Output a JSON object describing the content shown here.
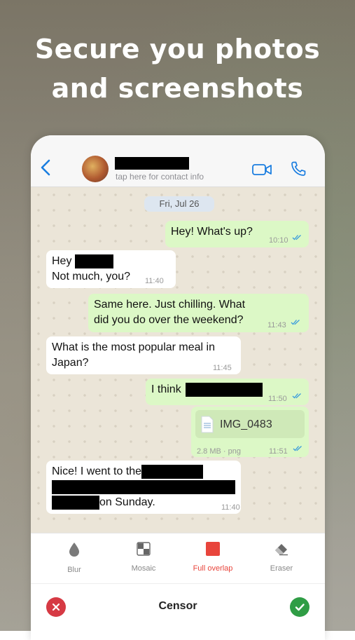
{
  "headline": {
    "line1": "Secure you photos",
    "line2": "and screenshots"
  },
  "chat_header": {
    "subtitle": "tap here for contact info"
  },
  "date_chip": "Fri, Jul 26",
  "messages": {
    "m1": {
      "text": "Hey! What's up?",
      "time": "10:10"
    },
    "m2": {
      "line1": "Hey",
      "line2": "Not much, you?",
      "time": "11:40"
    },
    "m3": {
      "line1": "Same here. Just chilling. What",
      "line2": "did you do over the weekend?",
      "time": "11:43"
    },
    "m4": {
      "line1": "What is the most popular meal in",
      "line2": "Japan?",
      "time": "11:45"
    },
    "m5": {
      "text": "I think",
      "time": "11:50"
    },
    "m6": {
      "filename": "IMG_0483",
      "meta": "2.8 MB · png",
      "time": "11:51"
    },
    "m7": {
      "line1": "Nice! I went to the",
      "line3": "on Sunday.",
      "time": "11:40"
    }
  },
  "tools": [
    {
      "label": "Blur",
      "icon": "drop-icon"
    },
    {
      "label": "Mosaic",
      "icon": "mosaic-icon"
    },
    {
      "label": "Full overlap",
      "icon": "square-icon",
      "active": true
    },
    {
      "label": "Eraser",
      "icon": "eraser-icon"
    }
  ],
  "footer": {
    "title": "Censor"
  },
  "colors": {
    "accent": "#e8453c",
    "ios_blue": "#1a7de0",
    "bubble_out": "#dcf8c6",
    "cancel": "#d63a44",
    "confirm": "#2f9d45"
  }
}
